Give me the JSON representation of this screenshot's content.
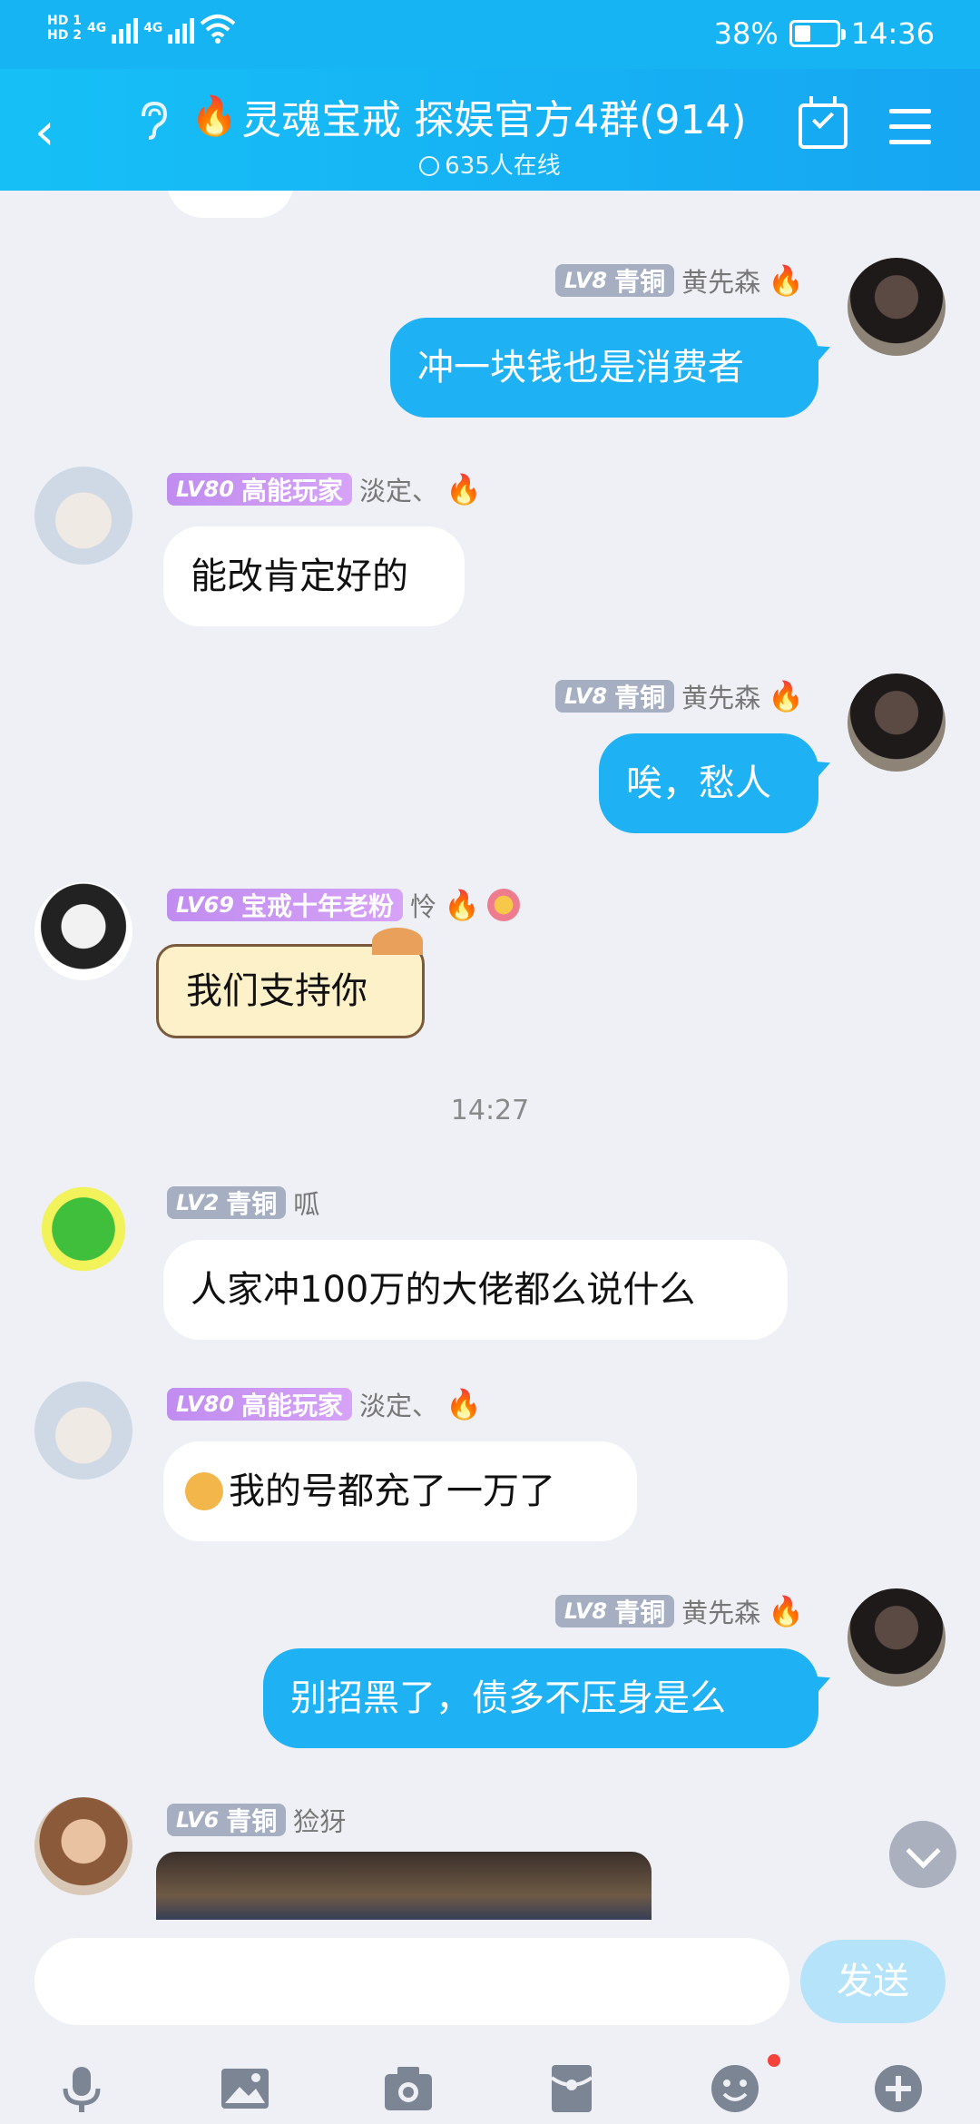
{
  "status_bar": {
    "hd1": "HD 1",
    "hd2": "HD 2",
    "network1": "4G",
    "network2": "4G",
    "battery_percent": "38%",
    "battery_level": 0.38,
    "time": "14:36"
  },
  "header": {
    "back_icon": "chevron-left-icon",
    "ear_icon": "ear-icon",
    "title": "灵魂宝戒 探娱官方4群(914)",
    "online": "635人在线",
    "calendar_icon": "calendar-check-icon",
    "menu_icon": "menu-icon"
  },
  "messages": [
    {
      "side": "out",
      "level": "LV8",
      "badge": "青铜",
      "name": "黄先森",
      "text": "冲一块钱也是消费者"
    },
    {
      "side": "in",
      "level": "LV80",
      "badge": "高能玩家",
      "name": "淡定、",
      "text": "能改肯定好的"
    },
    {
      "side": "out",
      "level": "LV8",
      "badge": "青铜",
      "name": "黄先森",
      "text": "唉，愁人"
    },
    {
      "side": "in",
      "level": "LV69",
      "badge": "宝戒十年老粉",
      "name": "怜",
      "text": "我们支持你"
    },
    {
      "timestamp": "14:27"
    },
    {
      "side": "in",
      "level": "LV2",
      "badge": "青铜",
      "name": "呱",
      "text": "人家冲100万的大佬都么说什么"
    },
    {
      "side": "in",
      "level": "LV80",
      "badge": "高能玩家",
      "name": "淡定、",
      "text": "我的号都充了一万了"
    },
    {
      "side": "out",
      "level": "LV8",
      "badge": "青铜",
      "name": "黄先森",
      "text": "别招黑了，债多不压身是么"
    },
    {
      "side": "in",
      "level": "LV6",
      "badge": "青铜",
      "name": "猃犽",
      "text": ""
    }
  ],
  "composer": {
    "placeholder": "",
    "send_label": "发送"
  },
  "toolbar": [
    "mic-icon",
    "image-icon",
    "camera-icon",
    "red-packet-icon",
    "emoji-icon",
    "plus-icon"
  ],
  "colors": {
    "accent": "#1eb1f3",
    "header": "#16b0f4",
    "background": "#eef0f5"
  }
}
